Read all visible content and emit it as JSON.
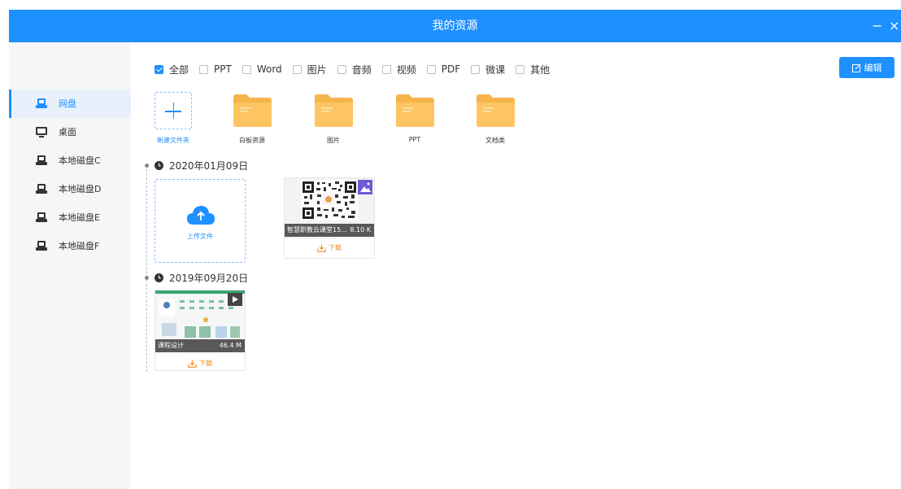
{
  "window": {
    "title": "我的资源",
    "minimize_label": "−",
    "close_label": "×"
  },
  "sidebar": {
    "items": [
      {
        "label": "网盘",
        "icon": "cloud-drive-icon",
        "active": true
      },
      {
        "label": "桌面",
        "icon": "desktop-icon",
        "active": false
      },
      {
        "label": "本地磁盘C",
        "icon": "disk-icon",
        "active": false
      },
      {
        "label": "本地磁盘D",
        "icon": "disk-icon",
        "active": false
      },
      {
        "label": "本地磁盘E",
        "icon": "disk-icon",
        "active": false
      },
      {
        "label": "本地磁盘F",
        "icon": "disk-icon",
        "active": false
      }
    ]
  },
  "filters": [
    {
      "label": "全部",
      "checked": true
    },
    {
      "label": "PPT",
      "checked": false
    },
    {
      "label": "Word",
      "checked": false
    },
    {
      "label": "图片",
      "checked": false
    },
    {
      "label": "音频",
      "checked": false
    },
    {
      "label": "视频",
      "checked": false
    },
    {
      "label": "PDF",
      "checked": false
    },
    {
      "label": "微课",
      "checked": false
    },
    {
      "label": "其他",
      "checked": false
    }
  ],
  "edit_button": {
    "label": "编辑"
  },
  "new_folder": {
    "label": "新建文件夹"
  },
  "folders": [
    {
      "label": "白板资源"
    },
    {
      "label": "图片"
    },
    {
      "label": "PPT"
    },
    {
      "label": "文档类"
    }
  ],
  "timeline": [
    {
      "date": "2020年01月09日",
      "upload_label": "上传文件",
      "files": [
        {
          "name": "智慧职教云课堂15...",
          "size": "8.10 K",
          "download_label": "下载",
          "type": "image"
        }
      ]
    },
    {
      "date": "2019年09月20日",
      "files": [
        {
          "name": "课程设计",
          "size": "46.4 M",
          "download_label": "下载",
          "type": "video"
        }
      ]
    }
  ],
  "colors": {
    "accent": "#1e90ff",
    "folder": "#fdc05a",
    "download": "#f08a24"
  }
}
